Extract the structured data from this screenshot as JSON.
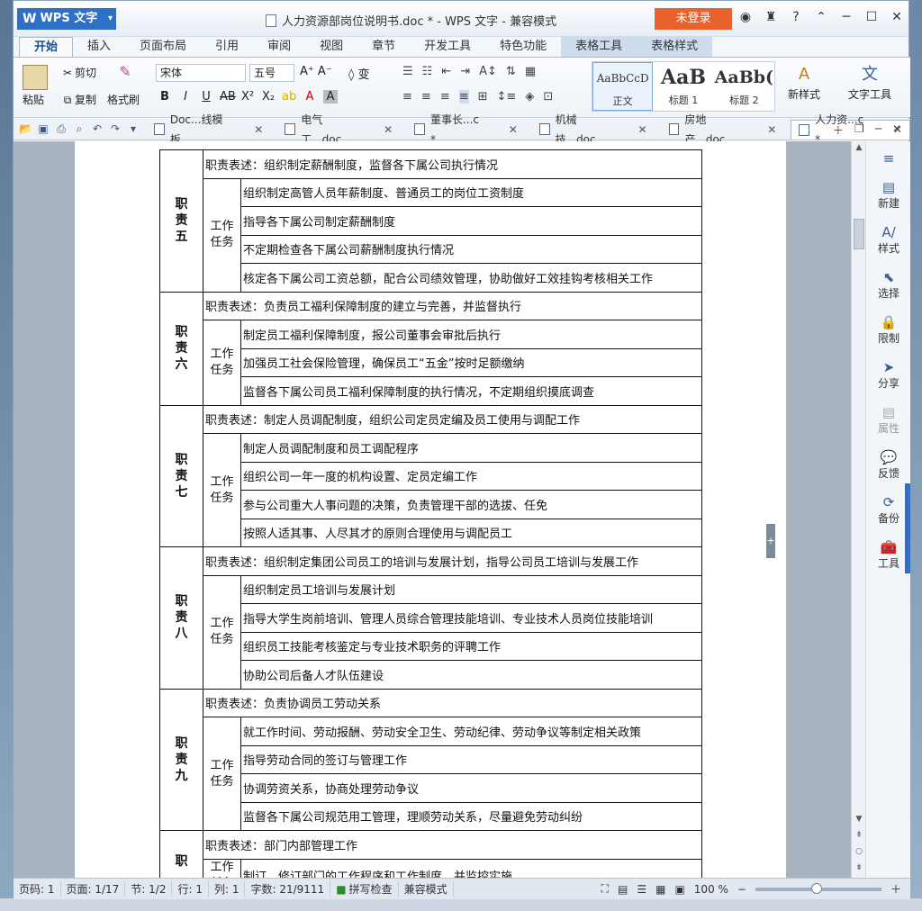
{
  "app": {
    "logo_label": "WPS 文字",
    "doc_title": "人力资源部岗位说明书.doc * - WPS 文字 - 兼容模式",
    "login_label": "未登录"
  },
  "ribbon_tabs": [
    {
      "label": "开始"
    },
    {
      "label": "插入"
    },
    {
      "label": "页面布局"
    },
    {
      "label": "引用"
    },
    {
      "label": "审阅"
    },
    {
      "label": "视图"
    },
    {
      "label": "章节"
    },
    {
      "label": "开发工具"
    },
    {
      "label": "特色功能"
    },
    {
      "label": "表格工具"
    },
    {
      "label": "表格样式"
    }
  ],
  "ribbon": {
    "paste": "粘贴",
    "cut": "剪切",
    "copy": "复制",
    "format_painter": "格式刷",
    "font_name": "宋体",
    "font_size": "五号",
    "styles": [
      {
        "sample": "AaBbCcD",
        "label": "正文"
      },
      {
        "sample": "AaB",
        "label": "标题 1"
      },
      {
        "sample": "AaBb(",
        "label": "标题 2"
      }
    ],
    "new_style": "新样式",
    "text_tools": "文字工具"
  },
  "doc_tabs": [
    {
      "label": "Doc...线模板"
    },
    {
      "label": "电气工...doc"
    },
    {
      "label": "董事长...c *"
    },
    {
      "label": "机械技...doc"
    },
    {
      "label": "房地产...doc"
    },
    {
      "label": "人力资...c *"
    }
  ],
  "table": {
    "work_label": "工作任务",
    "blocks": [
      {
        "duty": "职责五",
        "desc": "职责表述：组织制定薪酬制度，监督各下属公司执行情况",
        "tasks": [
          "组织制定高管人员年薪制度、普通员工的岗位工资制度",
          "指导各下属公司制定薪酬制度",
          "不定期检查各下属公司薪酬制度执行情况",
          "核定各下属公司工资总额，配合公司绩效管理，协助做好工效挂钩考核相关工作"
        ]
      },
      {
        "duty": "职责六",
        "desc": "职责表述：负责员工福利保障制度的建立与完善，并监督执行",
        "tasks": [
          "制定员工福利保障制度，报公司董事会审批后执行",
          "加强员工社会保险管理，确保员工“五金”按时足额缴纳",
          "监督各下属公司员工福利保障制度的执行情况，不定期组织摸底调查"
        ]
      },
      {
        "duty": "职责七",
        "desc": "职责表述：制定人员调配制度，组织公司定员定编及员工使用与调配工作",
        "tasks": [
          "制定人员调配制度和员工调配程序",
          "组织公司一年一度的机构设置、定员定编工作",
          "参与公司重大人事问题的决策，负责管理干部的选拔、任免",
          "按照人适其事、人尽其才的原则合理使用与调配员工"
        ]
      },
      {
        "duty": "职责八",
        "desc": "职责表述：组织制定集团公司员工的培训与发展计划，指导公司员工培训与发展工作",
        "tasks": [
          "组织制定员工培训与发展计划",
          "指导大学生岗前培训、管理人员综合管理技能培训、专业技术人员岗位技能培训",
          "组织员工技能考核鉴定与专业技术职务的评聘工作",
          "协助公司后备人才队伍建设"
        ]
      },
      {
        "duty": "职责九",
        "desc": "职责表述：负责协调员工劳动关系",
        "tasks": [
          "就工作时间、劳动报酬、劳动安全卫生、劳动纪律、劳动争议等制定相关政策",
          "指导劳动合同的签订与管理工作",
          "协调劳资关系，协商处理劳动争议",
          "监督各下属公司规范用工管理，理顺劳动关系，尽量避免劳动纠纷"
        ]
      },
      {
        "duty": "职",
        "desc": "职责表述：部门内部管理工作",
        "tasks": [
          "制订、修订部门的工作程序和工作制度，并监控实施"
        ]
      }
    ]
  },
  "side_pane": [
    {
      "label": "新建"
    },
    {
      "label": "样式"
    },
    {
      "label": "选择"
    },
    {
      "label": "限制"
    },
    {
      "label": "分享"
    },
    {
      "label": "属性"
    },
    {
      "label": "反馈"
    },
    {
      "label": "备份"
    },
    {
      "label": "工具"
    }
  ],
  "status": {
    "page_code": "页码: 1",
    "pages": "页面: 1/17",
    "section": "节: 1/2",
    "row": "行: 1",
    "col": "列: 1",
    "words": "字数: 21/9111",
    "spell": "拼写检查",
    "compat": "兼容模式",
    "zoom": "100 %"
  },
  "colors": {
    "accent": "#2e6fc7",
    "login": "#e8622b"
  }
}
